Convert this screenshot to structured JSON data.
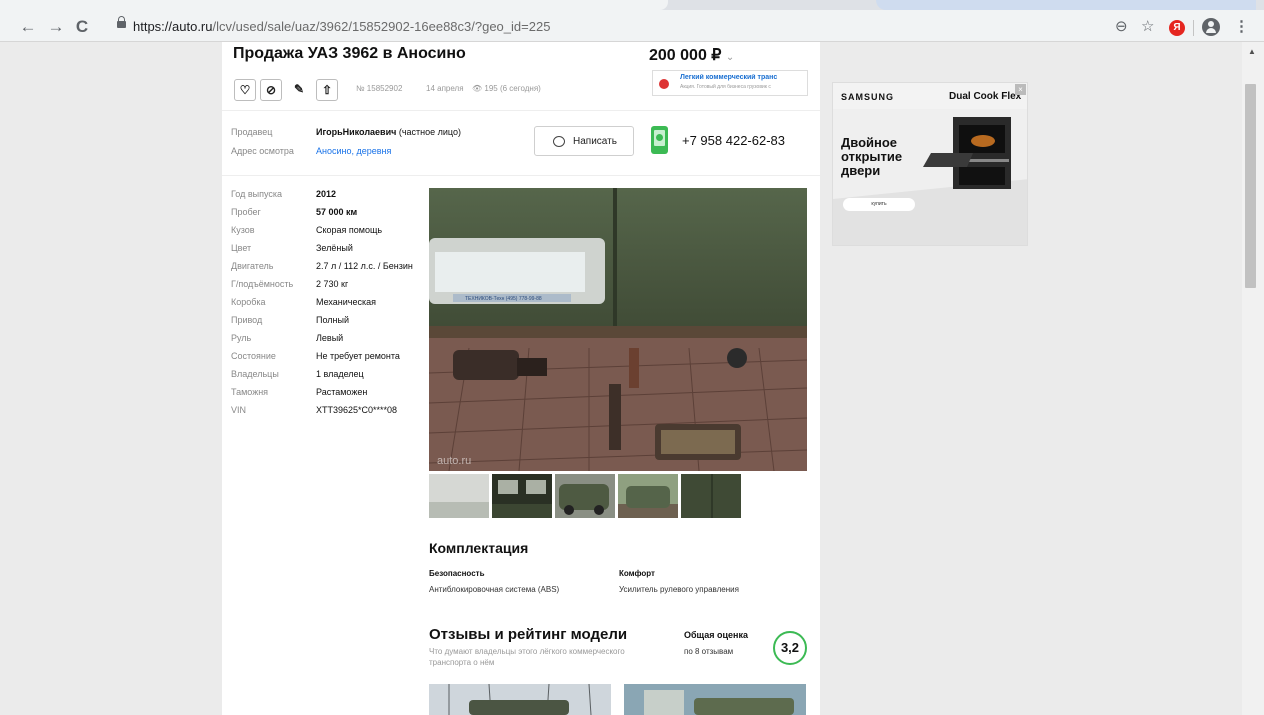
{
  "browser": {
    "url_host": "https://auto.ru",
    "url_path": "/lcv/used/sale/uaz/3962/15852902-16ee88c3/?geo_id=225",
    "back_icon": "←",
    "forward_icon": "→",
    "reload_icon": "C",
    "zoom_icon": "⊖",
    "star_icon": "☆",
    "yandex_label": "Я",
    "menu_icon": "⋮"
  },
  "listing": {
    "title": "Продажа УАЗ 3962 в Аносино",
    "price": "200 000 ₽",
    "price_caret": "⌄",
    "actions": {
      "favorite": "♡",
      "block": "⊘",
      "note": "✎",
      "share": "⇧"
    },
    "listing_number": "№ 15852902",
    "date": "14 апреля",
    "views": "195 (6 сегодня)",
    "views_icon": "👁",
    "ad_banner": {
      "title": "Легкий коммерческий транс",
      "text": "Акция. Готовый для бизнеса грузовик с"
    }
  },
  "seller": {
    "seller_label": "Продавец",
    "seller_name": "ИгорьНиколаевич",
    "seller_type": " (частное лицо)",
    "address_label": "Адрес осмотра",
    "address": "Аносино, деревня",
    "write_button": "Написать",
    "phone": "+7 958 422-62-83"
  },
  "specs": [
    {
      "label": "Год выпуска",
      "value": "2012",
      "bold": true
    },
    {
      "label": "Пробег",
      "value": "57 000 км",
      "bold": true
    },
    {
      "label": "Кузов",
      "value": "Скорая помощь"
    },
    {
      "label": "Цвет",
      "value": "Зелёный"
    },
    {
      "label": "Двигатель",
      "value": "2.7 л / 112 л.с. / Бензин"
    },
    {
      "label": "Г/подъёмность",
      "value": "2 730 кг"
    },
    {
      "label": "Коробка",
      "value": "Механическая"
    },
    {
      "label": "Привод",
      "value": "Полный"
    },
    {
      "label": "Руль",
      "value": "Левый"
    },
    {
      "label": "Состояние",
      "value": "Не требует ремонта"
    },
    {
      "label": "Владельцы",
      "value": "1 владелец"
    },
    {
      "label": "Таможня",
      "value": "Растаможен"
    },
    {
      "label": "VIN",
      "value": "XTT39625*C0****08"
    }
  ],
  "photo": {
    "watermark": "auto.ru",
    "plate_text": "ТЕХНИКОВ-Техн (495) 778-99-88"
  },
  "equipment": {
    "heading": "Комплектация",
    "groups": [
      {
        "title": "Безопасность",
        "item": "Антиблокировочная система (ABS)"
      },
      {
        "title": "Комфорт",
        "item": "Усилитель рулевого управления"
      }
    ]
  },
  "reviews": {
    "heading": "Отзывы и рейтинг модели",
    "subtitle_line1": "Что думают владельцы этого лёгкого коммерческого",
    "subtitle_line2": "транспорта о нём",
    "overall_label": "Общая оценка",
    "reviews_link": "по 8 отзывам",
    "score": "3,2"
  },
  "side_ad": {
    "brand": "SAMSUNG",
    "product": "Dual Cook Flex",
    "pitch": "Двойное открытие двери",
    "buy": "купить",
    "close": "×"
  },
  "colors": {
    "accent_link": "#1a73e8",
    "score_ring": "#3cba54",
    "phone_icon": "#3cba54"
  }
}
